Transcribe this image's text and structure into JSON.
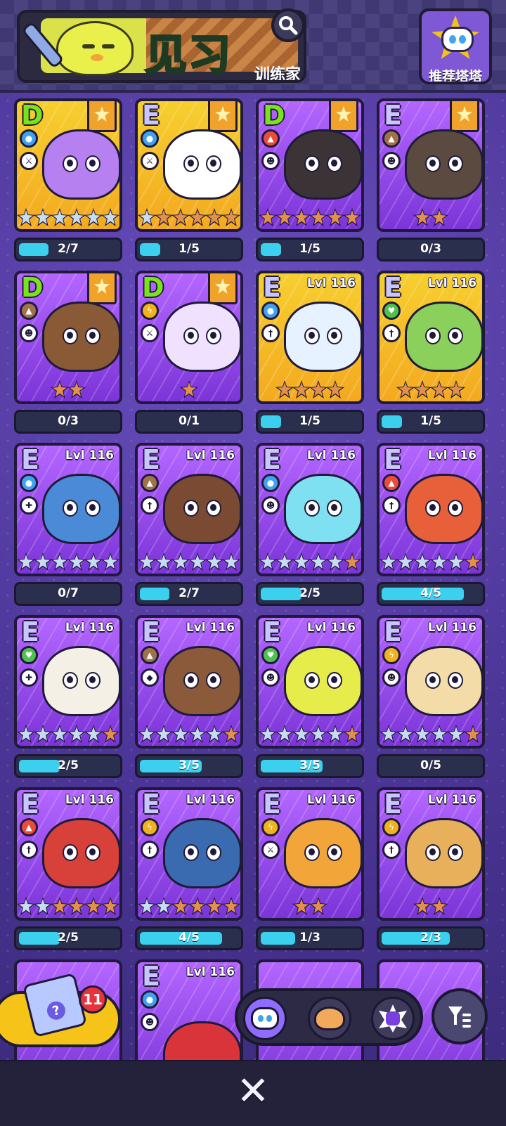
{
  "header": {
    "title": "见习",
    "subtitle": "训练家",
    "recommend_label": "推荐塔塔"
  },
  "cards": [
    {
      "grade": "D",
      "level": "",
      "badge": true,
      "element": "water",
      "role": "swords",
      "stars": [
        "s",
        "s",
        "s",
        "s",
        "s",
        "s"
      ],
      "progress": "2/7",
      "fill": 0.286,
      "color": "#b680f0",
      "frame": "gold"
    },
    {
      "grade": "E",
      "level": "",
      "badge": true,
      "element": "water",
      "role": "swords",
      "stars": [
        "s",
        "b",
        "b",
        "b",
        "b",
        "b"
      ],
      "progress": "1/5",
      "fill": 0.2,
      "color": "#ffffff",
      "frame": "gold"
    },
    {
      "grade": "D",
      "level": "",
      "badge": true,
      "element": "fire",
      "role": "mask",
      "stars": [
        "b",
        "b",
        "b",
        "b",
        "b",
        "b"
      ],
      "progress": "1/5",
      "fill": 0.2,
      "color": "#3b3336",
      "frame": "purple"
    },
    {
      "grade": "E",
      "level": "",
      "badge": true,
      "element": "earth",
      "role": "mask",
      "stars": [
        "b",
        "b"
      ],
      "progress": "0/3",
      "fill": 0,
      "color": "#5b4a3f",
      "frame": "purple"
    },
    {
      "grade": "D",
      "level": "",
      "badge": true,
      "element": "earth",
      "role": "mask",
      "stars": [
        "b",
        "b"
      ],
      "progress": "0/3",
      "fill": 0,
      "color": "#8a5a36",
      "frame": "purple"
    },
    {
      "grade": "D",
      "level": "",
      "badge": true,
      "element": "electric",
      "role": "swords",
      "stars": [
        "b"
      ],
      "progress": "0/1",
      "fill": 0,
      "color": "#f0e2ff",
      "frame": "purple"
    },
    {
      "grade": "E",
      "level": "Lvl 116",
      "badge": false,
      "element": "water",
      "role": "dagger",
      "stars": [
        "b",
        "b",
        "b",
        "b"
      ],
      "progress": "1/5",
      "fill": 0.2,
      "color": "#e6f2ff",
      "frame": "gold"
    },
    {
      "grade": "E",
      "level": "Lvl 116",
      "badge": false,
      "element": "grass",
      "role": "dagger",
      "stars": [
        "b",
        "b",
        "b",
        "b"
      ],
      "progress": "1/5",
      "fill": 0.2,
      "color": "#8ad05a",
      "frame": "gold"
    },
    {
      "grade": "E",
      "level": "Lvl 116",
      "badge": false,
      "element": "water",
      "role": "cross",
      "stars": [
        "s",
        "s",
        "s",
        "s",
        "s",
        "s"
      ],
      "progress": "0/7",
      "fill": 0,
      "color": "#4a8ad6",
      "frame": "purple"
    },
    {
      "grade": "E",
      "level": "Lvl 116",
      "badge": false,
      "element": "earth",
      "role": "dagger",
      "stars": [
        "s",
        "s",
        "s",
        "s",
        "s",
        "s"
      ],
      "progress": "2/7",
      "fill": 0.286,
      "color": "#7a4a32",
      "frame": "purple"
    },
    {
      "grade": "E",
      "level": "Lvl 116",
      "badge": false,
      "element": "water",
      "role": "mask",
      "stars": [
        "s",
        "s",
        "s",
        "s",
        "s",
        "b"
      ],
      "progress": "2/5",
      "fill": 0.4,
      "color": "#7ee0f0",
      "frame": "purple"
    },
    {
      "grade": "E",
      "level": "Lvl 116",
      "badge": false,
      "element": "fire",
      "role": "dagger",
      "stars": [
        "s",
        "s",
        "s",
        "s",
        "s",
        "b"
      ],
      "progress": "4/5",
      "fill": 0.8,
      "color": "#e8603a",
      "frame": "purple"
    },
    {
      "grade": "E",
      "level": "Lvl 116",
      "badge": false,
      "element": "grass",
      "role": "cross",
      "stars": [
        "s",
        "s",
        "s",
        "s",
        "s",
        "b"
      ],
      "progress": "2/5",
      "fill": 0.4,
      "color": "#f4f0e6",
      "frame": "purple"
    },
    {
      "grade": "E",
      "level": "Lvl 116",
      "badge": false,
      "element": "earth",
      "role": "shield",
      "stars": [
        "s",
        "s",
        "s",
        "s",
        "s",
        "b"
      ],
      "progress": "3/5",
      "fill": 0.6,
      "color": "#8a5a3a",
      "frame": "purple"
    },
    {
      "grade": "E",
      "level": "Lvl 116",
      "badge": false,
      "element": "grass",
      "role": "mask",
      "stars": [
        "s",
        "s",
        "s",
        "s",
        "s",
        "b"
      ],
      "progress": "3/5",
      "fill": 0.6,
      "color": "#e6ec4a",
      "frame": "purple"
    },
    {
      "grade": "E",
      "level": "Lvl 116",
      "badge": false,
      "element": "electric",
      "role": "mask",
      "stars": [
        "s",
        "s",
        "s",
        "s",
        "s",
        "b"
      ],
      "progress": "0/5",
      "fill": 0,
      "color": "#f4dca8",
      "frame": "purple"
    },
    {
      "grade": "E",
      "level": "Lvl 116",
      "badge": false,
      "element": "fire",
      "role": "dagger",
      "stars": [
        "s",
        "s",
        "b",
        "b",
        "b",
        "b"
      ],
      "progress": "2/5",
      "fill": 0.4,
      "color": "#d8403a",
      "frame": "purple"
    },
    {
      "grade": "E",
      "level": "Lvl 116",
      "badge": false,
      "element": "electric",
      "role": "dagger",
      "stars": [
        "s",
        "s",
        "b",
        "b",
        "b",
        "b"
      ],
      "progress": "4/5",
      "fill": 0.8,
      "color": "#3a6ab0",
      "frame": "purple"
    },
    {
      "grade": "E",
      "level": "Lvl 116",
      "badge": false,
      "element": "electric",
      "role": "swords",
      "stars": [
        "b",
        "b"
      ],
      "progress": "1/3",
      "fill": 0.333,
      "color": "#f2a63a",
      "frame": "purple"
    },
    {
      "grade": "E",
      "level": "Lvl 116",
      "badge": false,
      "element": "electric",
      "role": "dagger",
      "stars": [
        "b",
        "b"
      ],
      "progress": "2/3",
      "fill": 0.667,
      "color": "#e8b05a",
      "frame": "purple"
    }
  ],
  "partial_cards": [
    {
      "grade": "E",
      "level": "Lvl 116",
      "element": "water",
      "role": "mask",
      "color": "#d8343a"
    }
  ],
  "box": {
    "count": "11"
  },
  "bottom": {
    "close": "✕"
  }
}
